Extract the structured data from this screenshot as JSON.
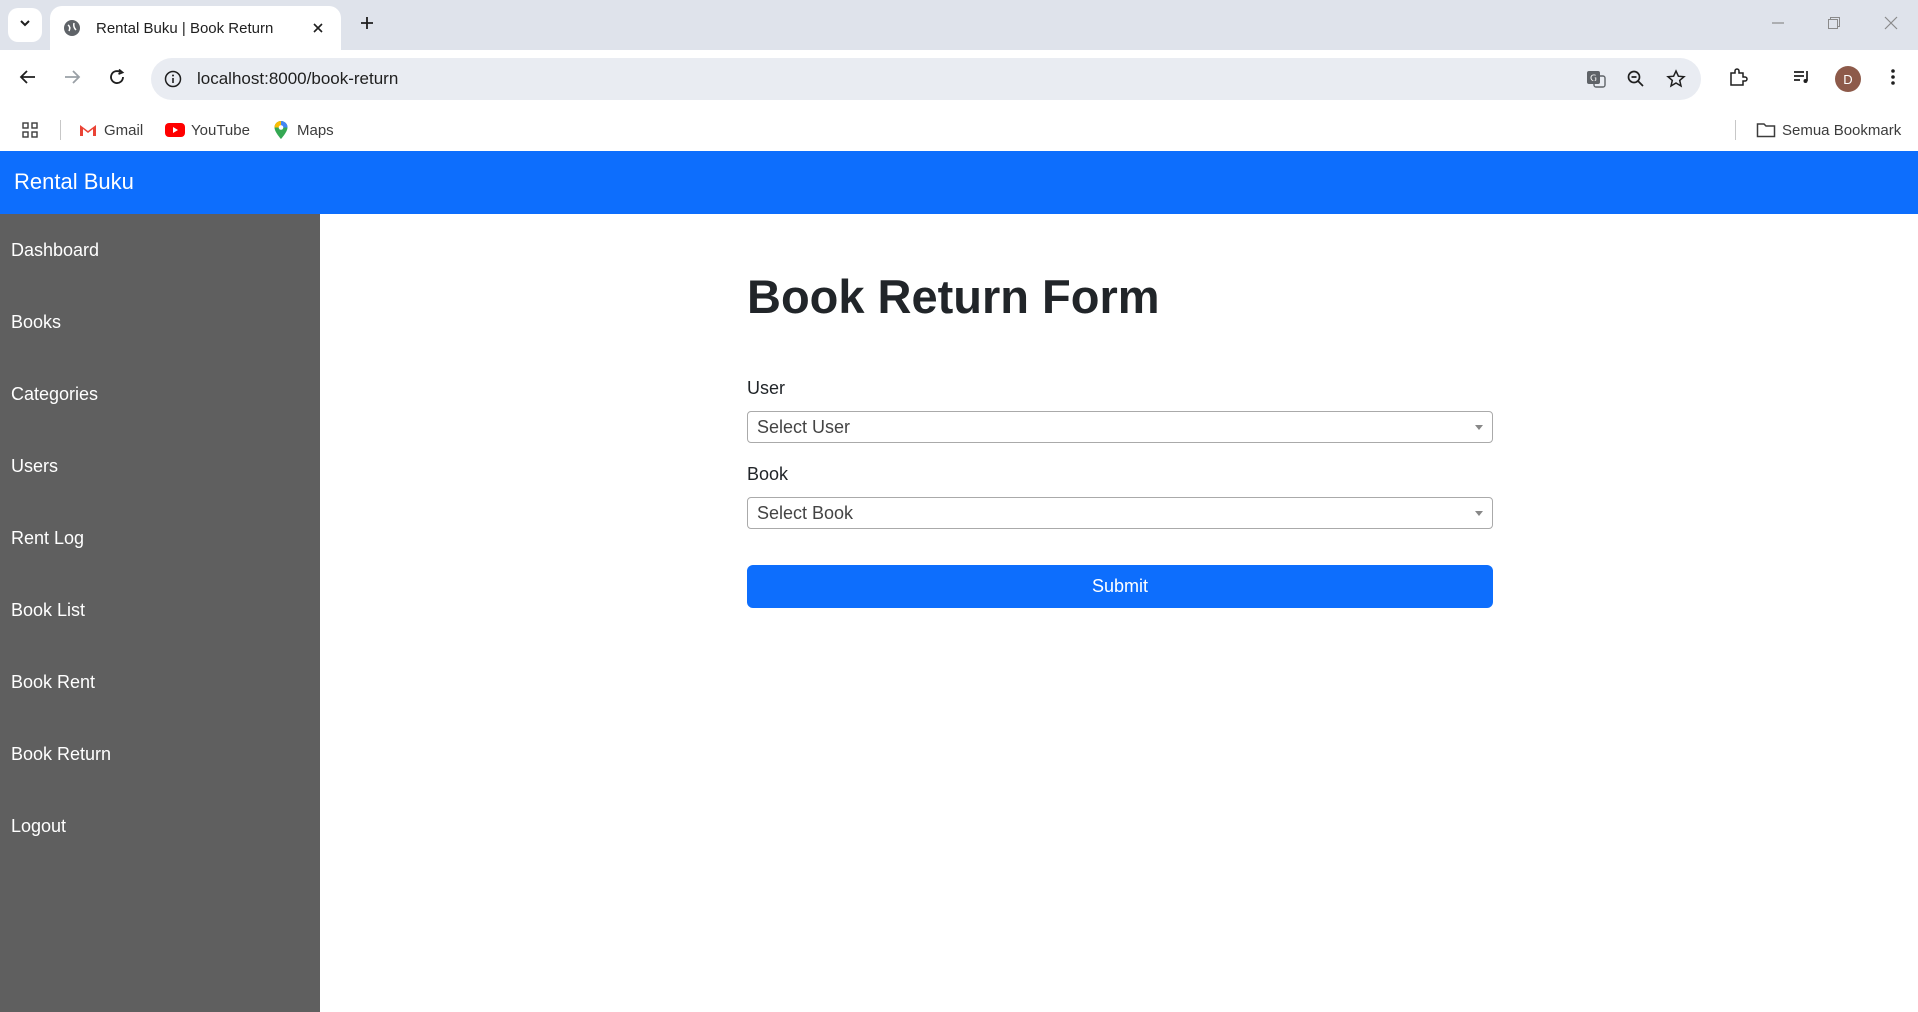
{
  "browser": {
    "tab_title": "Rental Buku | Book Return",
    "url": "localhost:8000/book-return",
    "avatar_initial": "D",
    "bookmarks": [
      {
        "label": "Gmail",
        "icon": "gmail-icon"
      },
      {
        "label": "YouTube",
        "icon": "youtube-icon"
      },
      {
        "label": "Maps",
        "icon": "maps-icon"
      }
    ],
    "all_bookmarks_label": "Semua Bookmark"
  },
  "app": {
    "brand": "Rental Buku",
    "colors": {
      "primary": "#0d6efd",
      "sidebar": "#5f5f5f"
    }
  },
  "sidebar": {
    "items": [
      {
        "label": "Dashboard"
      },
      {
        "label": "Books"
      },
      {
        "label": "Categories"
      },
      {
        "label": "Users"
      },
      {
        "label": "Rent Log"
      },
      {
        "label": "Book List"
      },
      {
        "label": "Book Rent"
      },
      {
        "label": "Book Return"
      },
      {
        "label": "Logout"
      }
    ]
  },
  "form": {
    "title": "Book Return Form",
    "user_label": "User",
    "user_placeholder": "Select User",
    "book_label": "Book",
    "book_placeholder": "Select Book",
    "submit_label": "Submit"
  }
}
